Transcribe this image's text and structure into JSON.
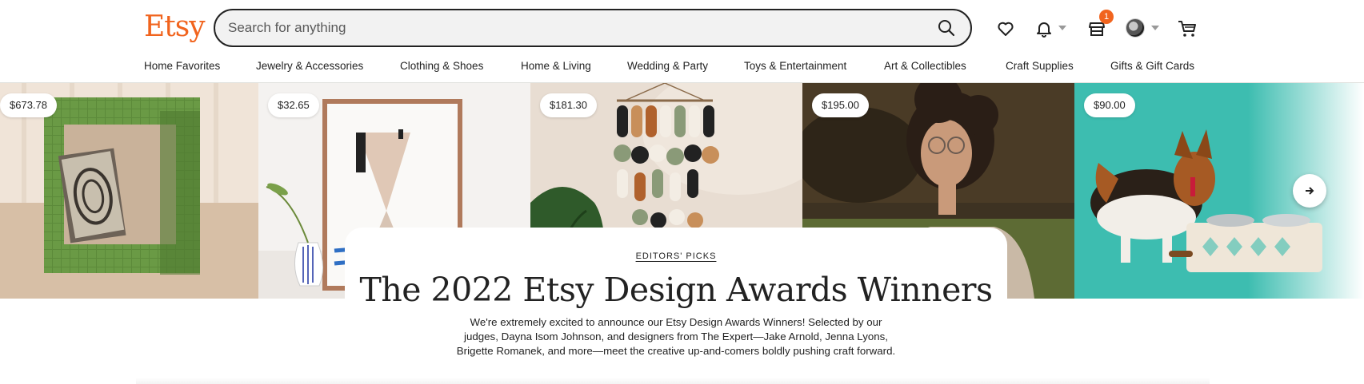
{
  "brand": {
    "logo_text": "Etsy",
    "accent_color": "#f1641e"
  },
  "search": {
    "placeholder": "Search for anything",
    "value": ""
  },
  "header_icons": {
    "favorites": "heart-icon",
    "notifications": "bell-icon",
    "shop_manager": "store-icon",
    "shop_badge_count": "1",
    "account": "avatar",
    "cart": "cart-icon"
  },
  "nav": {
    "categories": [
      "Home Favorites",
      "Jewelry & Accessories",
      "Clothing & Shoes",
      "Home & Living",
      "Wedding & Party",
      "Toys & Entertainment",
      "Art & Collectibles",
      "Craft Supplies",
      "Gifts & Gift Cards"
    ]
  },
  "hero": {
    "listings": [
      {
        "price": "$673.78"
      },
      {
        "price": "$32.65"
      },
      {
        "price": "$181.30"
      },
      {
        "price": "$195.00"
      },
      {
        "price": "$90.00"
      }
    ],
    "next_icon": "arrow-right-icon"
  },
  "editorial": {
    "eyebrow": "EDITORS' PICKS",
    "headline": "The 2022 Etsy Design Awards Winners",
    "blurb": "We're extremely excited to announce our Etsy Design Awards Winners! Selected by our judges, Dayna Isom Johnson, and designers from The Expert—Jake Arnold, Jenna Lyons, Brigette Romanek, and more—meet the creative up-and-comers boldly pushing craft forward."
  }
}
